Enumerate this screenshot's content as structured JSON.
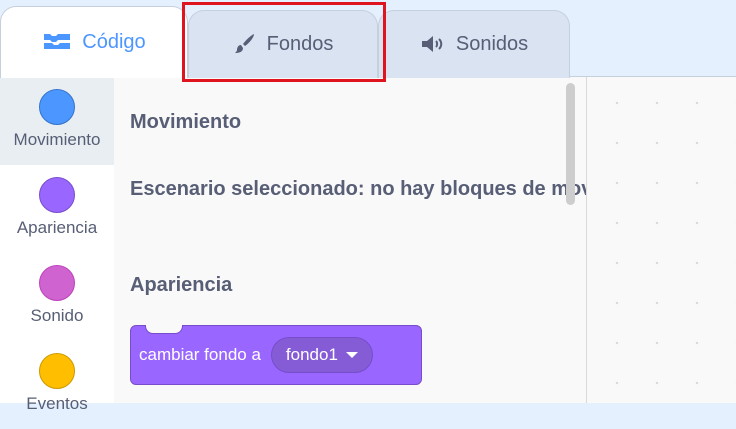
{
  "tabs": [
    {
      "label": "Código",
      "icon": "code-blocks-icon",
      "active": true
    },
    {
      "label": "Fondos",
      "icon": "paintbrush-icon",
      "active": false,
      "highlighted": true
    },
    {
      "label": "Sonidos",
      "icon": "speaker-icon",
      "active": false
    }
  ],
  "categories": [
    {
      "label": "Movimiento",
      "color": "#4c97ff",
      "selected": true
    },
    {
      "label": "Apariencia",
      "color": "#9966ff",
      "selected": false
    },
    {
      "label": "Sonido",
      "color": "#cf63cf",
      "selected": false
    },
    {
      "label": "Eventos",
      "color": "#ffbf00",
      "selected": false
    }
  ],
  "flyout": {
    "motion_heading": "Movimiento",
    "motion_note": "Escenario seleccionado: no hay bloques de movimiento",
    "looks_heading": "Apariencia",
    "block": {
      "label": "cambiar fondo a",
      "dropdown_value": "fondo1"
    }
  },
  "colors": {
    "accent": "#4c97ff",
    "looks_block": "#9966ff",
    "highlight_box": "#e0141e",
    "tab_text": "#575e75"
  }
}
